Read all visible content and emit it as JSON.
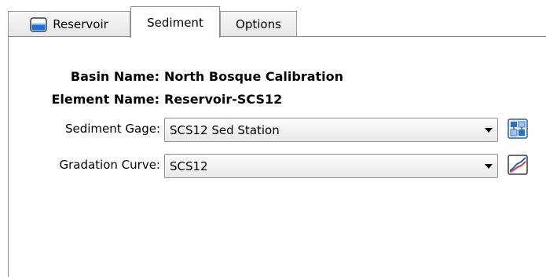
{
  "tabs": [
    {
      "label": "Reservoir",
      "icon": "reservoir-icon",
      "selected": false
    },
    {
      "label": "Sediment",
      "selected": true
    },
    {
      "label": "Options",
      "selected": false
    }
  ],
  "info": {
    "basin_label": "Basin Name:",
    "basin_value": "North Bosque Calibration",
    "element_label": "Element Name:",
    "element_value": "Reservoir-SCS12"
  },
  "fields": {
    "sediment_gage": {
      "label": "Sediment Gage:",
      "value": "SCS12 Sed Station",
      "icon": "gage-manager-icon"
    },
    "gradation_curve": {
      "label": "Gradation Curve:",
      "value": "SCS12",
      "icon": "curve-icon"
    }
  }
}
